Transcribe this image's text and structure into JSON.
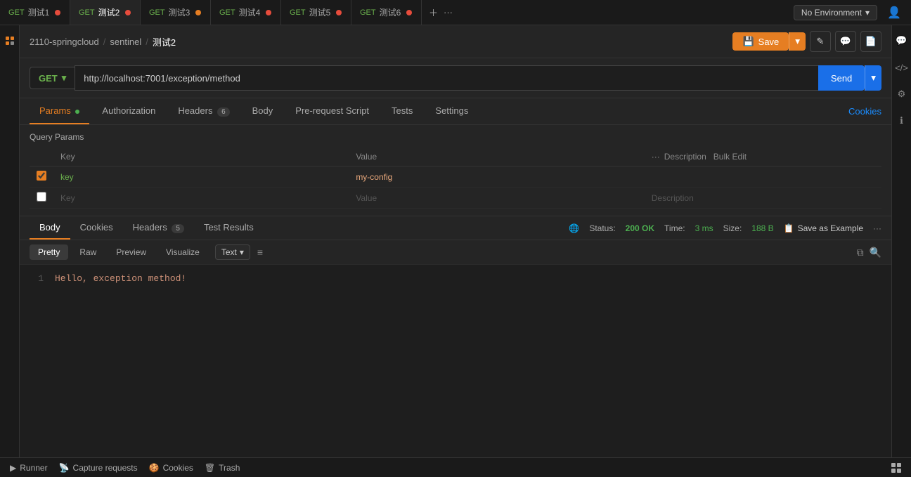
{
  "tabs": [
    {
      "method": "GET",
      "name": "测试1",
      "dot": "red",
      "active": false
    },
    {
      "method": "GET",
      "name": "测试2",
      "dot": "red",
      "active": true
    },
    {
      "method": "GET",
      "name": "测试3",
      "dot": "red",
      "active": false
    },
    {
      "method": "GET",
      "name": "测试4",
      "dot": "red",
      "active": false
    },
    {
      "method": "GET",
      "name": "测试5",
      "dot": "red",
      "active": false
    },
    {
      "method": "GET",
      "name": "测试6",
      "dot": "red",
      "active": false
    }
  ],
  "env": {
    "label": "No Environment"
  },
  "breadcrumb": {
    "part1": "2110-springcloud",
    "sep1": "/",
    "part2": "sentinel",
    "sep2": "/",
    "current": "测试2"
  },
  "toolbar": {
    "save_label": "Save",
    "edit_icon": "✎",
    "comment_icon": "💬",
    "doc_icon": "📄"
  },
  "request": {
    "method": "GET",
    "url": "http://localhost:7001/exception/method",
    "send_label": "Send"
  },
  "req_tabs": {
    "params_label": "Params",
    "auth_label": "Authorization",
    "headers_label": "Headers",
    "headers_count": "6",
    "body_label": "Body",
    "pre_script_label": "Pre-request Script",
    "tests_label": "Tests",
    "settings_label": "Settings",
    "cookies_label": "Cookies"
  },
  "query_params": {
    "title": "Query Params",
    "col_key": "Key",
    "col_value": "Value",
    "col_desc": "Description",
    "bulk_edit": "Bulk Edit",
    "rows": [
      {
        "key": "key",
        "value": "my-config",
        "desc": ""
      },
      {
        "key": "",
        "value": "",
        "desc": ""
      }
    ],
    "placeholder_key": "Key",
    "placeholder_value": "Value",
    "placeholder_desc": "Description"
  },
  "response": {
    "body_tab": "Body",
    "cookies_tab": "Cookies",
    "headers_tab": "Headers",
    "headers_count": "5",
    "test_results_tab": "Test Results",
    "status_label": "Status:",
    "status_code": "200 OK",
    "time_label": "Time:",
    "time_value": "3 ms",
    "size_label": "Size:",
    "size_value": "188 B",
    "save_example": "Save as Example",
    "globe_icon": "🌐"
  },
  "resp_body": {
    "pretty_tab": "Pretty",
    "raw_tab": "Raw",
    "preview_tab": "Preview",
    "visualize_tab": "Visualize",
    "text_label": "Text",
    "line_1": "Hello, exception method!",
    "line_num_1": "1"
  },
  "bottom_bar": {
    "runner_label": "Runner",
    "capture_label": "Capture requests",
    "cookies_label": "Cookies",
    "trash_label": "Trash"
  }
}
